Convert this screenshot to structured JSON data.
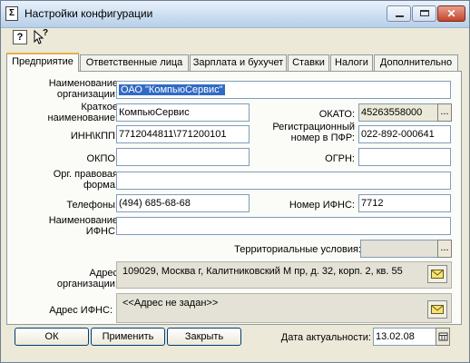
{
  "window": {
    "title": "Настройки конфигурации",
    "close_glyph": "✕",
    "app_icon_glyph": "Σ"
  },
  "toolbar": {
    "help_glyph": "?",
    "whatsthis_glyph": "?"
  },
  "tabs": [
    {
      "label": "Предприятие",
      "active": true
    },
    {
      "label": "Ответственные лица"
    },
    {
      "label": "Зарплата и бухучет"
    },
    {
      "label": "Ставки"
    },
    {
      "label": "Налоги"
    },
    {
      "label": "Дополнительно"
    }
  ],
  "form": {
    "org_name_label_1": "Наименование",
    "org_name_label_2": "организации:",
    "org_name_value": "ОАО \"КомпьюСервис\"",
    "short_name_label_1": "Краткое",
    "short_name_label_2": "наименование:",
    "short_name_value": "КомпьюСервис",
    "okato_label": "ОКАТО:",
    "okato_value": "45263558000",
    "inn_label": "ИНН\\КПП:",
    "inn_value": "7712044811\\771200101",
    "pfr_label_1": "Регистрационный",
    "pfr_label_2": "номер в ПФР:",
    "pfr_value": "022-892-000641",
    "okpo_label": "ОКПО:",
    "okpo_value": "",
    "ogrn_label": "ОГРН:",
    "ogrn_value": "",
    "legal_form_label_1": "Орг. правовая",
    "legal_form_label_2": "форма:",
    "legal_form_value": "",
    "phones_label": "Телефоны:",
    "phones_value": "(494) 685-68-68",
    "ifns_number_label": "Номер ИФНС:",
    "ifns_number_value": "7712",
    "ifns_name_label_1": "Наименование",
    "ifns_name_label_2": "ИФНС:",
    "ifns_name_value": "",
    "territorial_label": "Территориальные условия:",
    "territorial_value": "",
    "org_address_label_1": "Адрес",
    "org_address_label_2": "организации:",
    "org_address_value": "109029, Москва г, Калитниковский М пр, д. 32, корп. 2, кв. 55",
    "ifns_address_label": "Адрес ИФНС:",
    "ifns_address_value": "<<Адрес не задан>>",
    "ellipsis": "..."
  },
  "buttons": {
    "ok": "ОК",
    "apply": "Применить",
    "close": "Закрыть"
  },
  "date": {
    "label": "Дата актуальности:",
    "value": "13.02.08"
  }
}
